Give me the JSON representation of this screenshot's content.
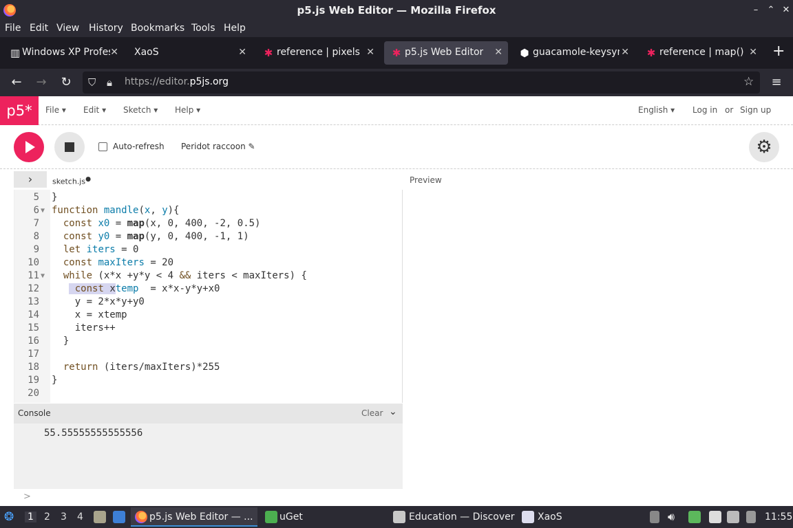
{
  "window": {
    "title": "p5.js Web Editor — Mozilla Firefox",
    "controls": [
      "–",
      "⌃",
      "✕"
    ]
  },
  "menubar": [
    "File",
    "Edit",
    "View",
    "History",
    "Bookmarks",
    "Tools",
    "Help"
  ],
  "tabs": [
    {
      "label": "Windows XP Profes",
      "icon": "document-icon",
      "active": false
    },
    {
      "label": "XaoS",
      "icon": "",
      "active": false
    },
    {
      "label": "reference | pixels",
      "icon": "p5-asterisk-icon",
      "active": false
    },
    {
      "label": "p5.js Web Editor",
      "icon": "p5-asterisk-icon",
      "active": true
    },
    {
      "label": "guacamole-keysym",
      "icon": "hexagon-icon",
      "active": false
    },
    {
      "label": "reference | map()",
      "icon": "p5-asterisk-icon",
      "active": false
    }
  ],
  "nav": {
    "url_prefix": "https://editor.",
    "url_domain": "p5js.org"
  },
  "p5": {
    "logo": "p5*",
    "menus": [
      "File",
      "Edit",
      "Sketch",
      "Help"
    ],
    "language": "English",
    "login": "Log in",
    "or": "or",
    "signup": "Sign up",
    "auto_refresh": "Auto-refresh",
    "sketch_name": "Peridot raccoon",
    "file_tab": "sketch.js",
    "preview_label": "Preview"
  },
  "code": {
    "line_numbers": [
      "5",
      "6",
      "7",
      "8",
      "9",
      "10",
      "11",
      "12",
      "13",
      "14",
      "15",
      "16",
      "17",
      "18",
      "19",
      "20"
    ]
  },
  "console": {
    "label": "Console",
    "clear": "Clear",
    "output": "55.55555555555556",
    "prompt": ">"
  },
  "taskbar": {
    "workspaces": [
      "1",
      "2",
      "3",
      "4"
    ],
    "apps": [
      {
        "label": "p5.js Web Editor — ...",
        "active": true
      },
      {
        "label": "uGet",
        "active": false
      },
      {
        "label": "Education — Discover",
        "active": false
      },
      {
        "label": "XaoS",
        "active": false
      }
    ],
    "clock": "11:55"
  },
  "colors": {
    "p5_pink": "#ed225d",
    "chrome_dark": "#2b2a33",
    "tabbar_dark": "#1c1b22"
  }
}
